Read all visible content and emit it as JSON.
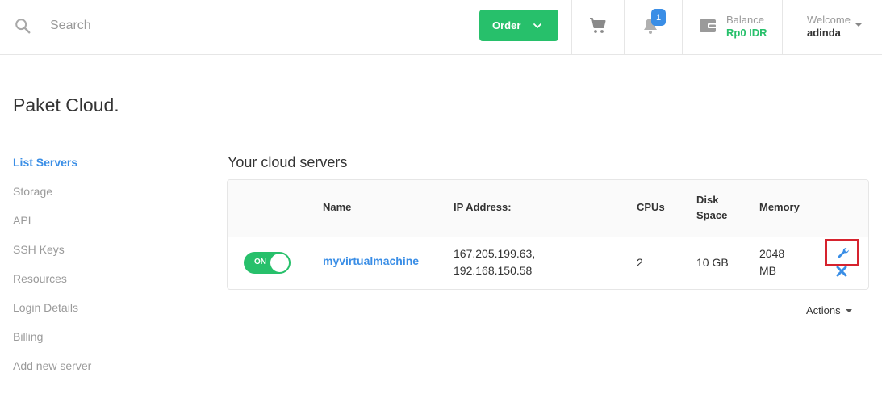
{
  "header": {
    "search_placeholder": "Search",
    "order_label": "Order",
    "notification_count": "1",
    "balance_label": "Balance",
    "balance_value": "Rp0 IDR",
    "welcome_label": "Welcome",
    "user_name": "adinda"
  },
  "page": {
    "title": "Paket Cloud."
  },
  "sidebar": {
    "items": [
      {
        "label": "List Servers",
        "active": true
      },
      {
        "label": "Storage"
      },
      {
        "label": "API"
      },
      {
        "label": "SSH Keys"
      },
      {
        "label": "Resources"
      },
      {
        "label": "Login Details"
      },
      {
        "label": "Billing"
      },
      {
        "label": "Add new server"
      }
    ]
  },
  "main": {
    "section_title": "Your cloud servers",
    "table": {
      "headers": {
        "name": "Name",
        "ip": "IP Address:",
        "cpus": "CPUs",
        "disk_line1": "Disk",
        "disk_line2": "Space",
        "memory": "Memory"
      },
      "rows": [
        {
          "toggle": "ON",
          "name": "myvirtualmachine",
          "ip_line1": "167.205.199.63,",
          "ip_line2": "192.168.150.58",
          "cpus": "2",
          "disk": "10 GB",
          "memory_line1": "2048",
          "memory_line2": "MB"
        }
      ]
    },
    "actions_label": "Actions"
  },
  "colors": {
    "accent_green": "#27c06b",
    "link_blue": "#3a8ee6",
    "highlight_red": "#d6232e"
  },
  "icons": {
    "search": "search-icon",
    "cart": "cart-icon",
    "bell": "bell-icon",
    "wallet": "wallet-icon",
    "wrench": "wrench-icon",
    "close": "close-icon"
  }
}
